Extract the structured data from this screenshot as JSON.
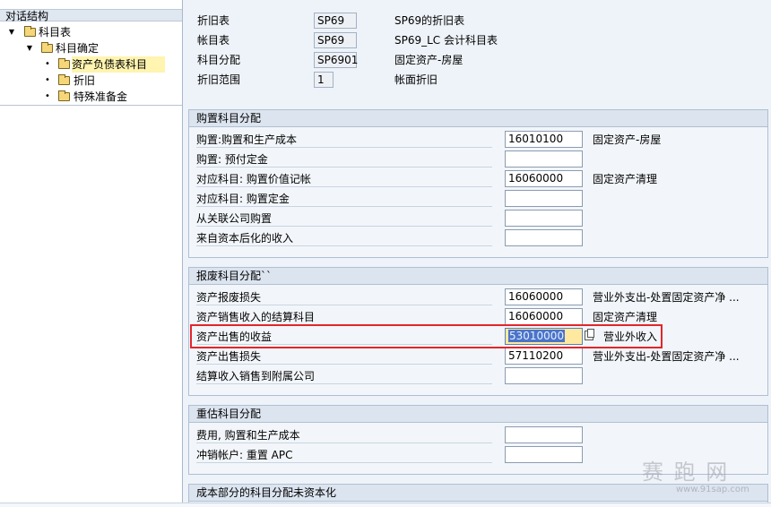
{
  "nav": {
    "header": "对话结构",
    "tree": [
      {
        "label": "科目表",
        "level": 0,
        "expanded": true
      },
      {
        "label": "科目确定",
        "level": 1,
        "expanded": true
      },
      {
        "label": "资产负债表科目",
        "level": 2,
        "selected": true
      },
      {
        "label": "折旧",
        "level": 2
      },
      {
        "label": "特殊准备金",
        "level": 2
      }
    ]
  },
  "header": {
    "rows": [
      {
        "label": "折旧表",
        "value": "SP69",
        "desc": "SP69的折旧表"
      },
      {
        "label": "帐目表",
        "value": "SP69",
        "desc": "SP69_LC 会计科目表"
      },
      {
        "label": "科目分配",
        "value": "SP6901",
        "desc": "固定资产-房屋"
      },
      {
        "label": "折旧范围",
        "value": "1",
        "desc": "帐面折旧"
      }
    ]
  },
  "groups": {
    "purchase": {
      "title": "购置科目分配",
      "rows": [
        {
          "label": "购置:购置和生产成本",
          "value": "16010100",
          "desc": "固定资产-房屋"
        },
        {
          "label": "购置: 预付定金",
          "value": "",
          "desc": ""
        },
        {
          "label": "对应科目: 购置价值记帐",
          "value": "16060000",
          "desc": "固定资产清理"
        },
        {
          "label": "对应科目: 购置定金",
          "value": "",
          "desc": ""
        },
        {
          "label": "从关联公司购置",
          "value": "",
          "desc": ""
        },
        {
          "label": "来自资本后化的收入",
          "value": "",
          "desc": ""
        }
      ]
    },
    "retirement": {
      "title": "报废科目分配``",
      "rows": [
        {
          "label": "资产报废损失",
          "value": "16060000",
          "desc": "营业外支出-处置固定资产净 ..."
        },
        {
          "label": "资产销售收入的结算科目",
          "value": "16060000",
          "desc": "固定资产清理"
        },
        {
          "label": "资产出售的收益",
          "value": "53010000",
          "desc": "营业外收入",
          "focused": true
        },
        {
          "label": "资产出售损失",
          "value": "57110200",
          "desc": "营业外支出-处置固定资产净 ..."
        },
        {
          "label": "结算收入销售到附属公司",
          "value": "",
          "desc": ""
        }
      ]
    },
    "revaluation": {
      "title": "重估科目分配",
      "rows": [
        {
          "label": "费用, 购置和生产成本",
          "value": "",
          "desc": ""
        },
        {
          "label": "冲销帐户: 重置 APC",
          "value": "",
          "desc": ""
        }
      ]
    },
    "cost": {
      "title": "成本部分的科目分配未资本化"
    }
  },
  "watermark": {
    "main": "赛 跑 网",
    "url": "www.91sap.com"
  },
  "colors": {
    "highlight": "#e1262c",
    "focus_bg": "#ffe9a0",
    "selected_node": "#fff4b0"
  }
}
